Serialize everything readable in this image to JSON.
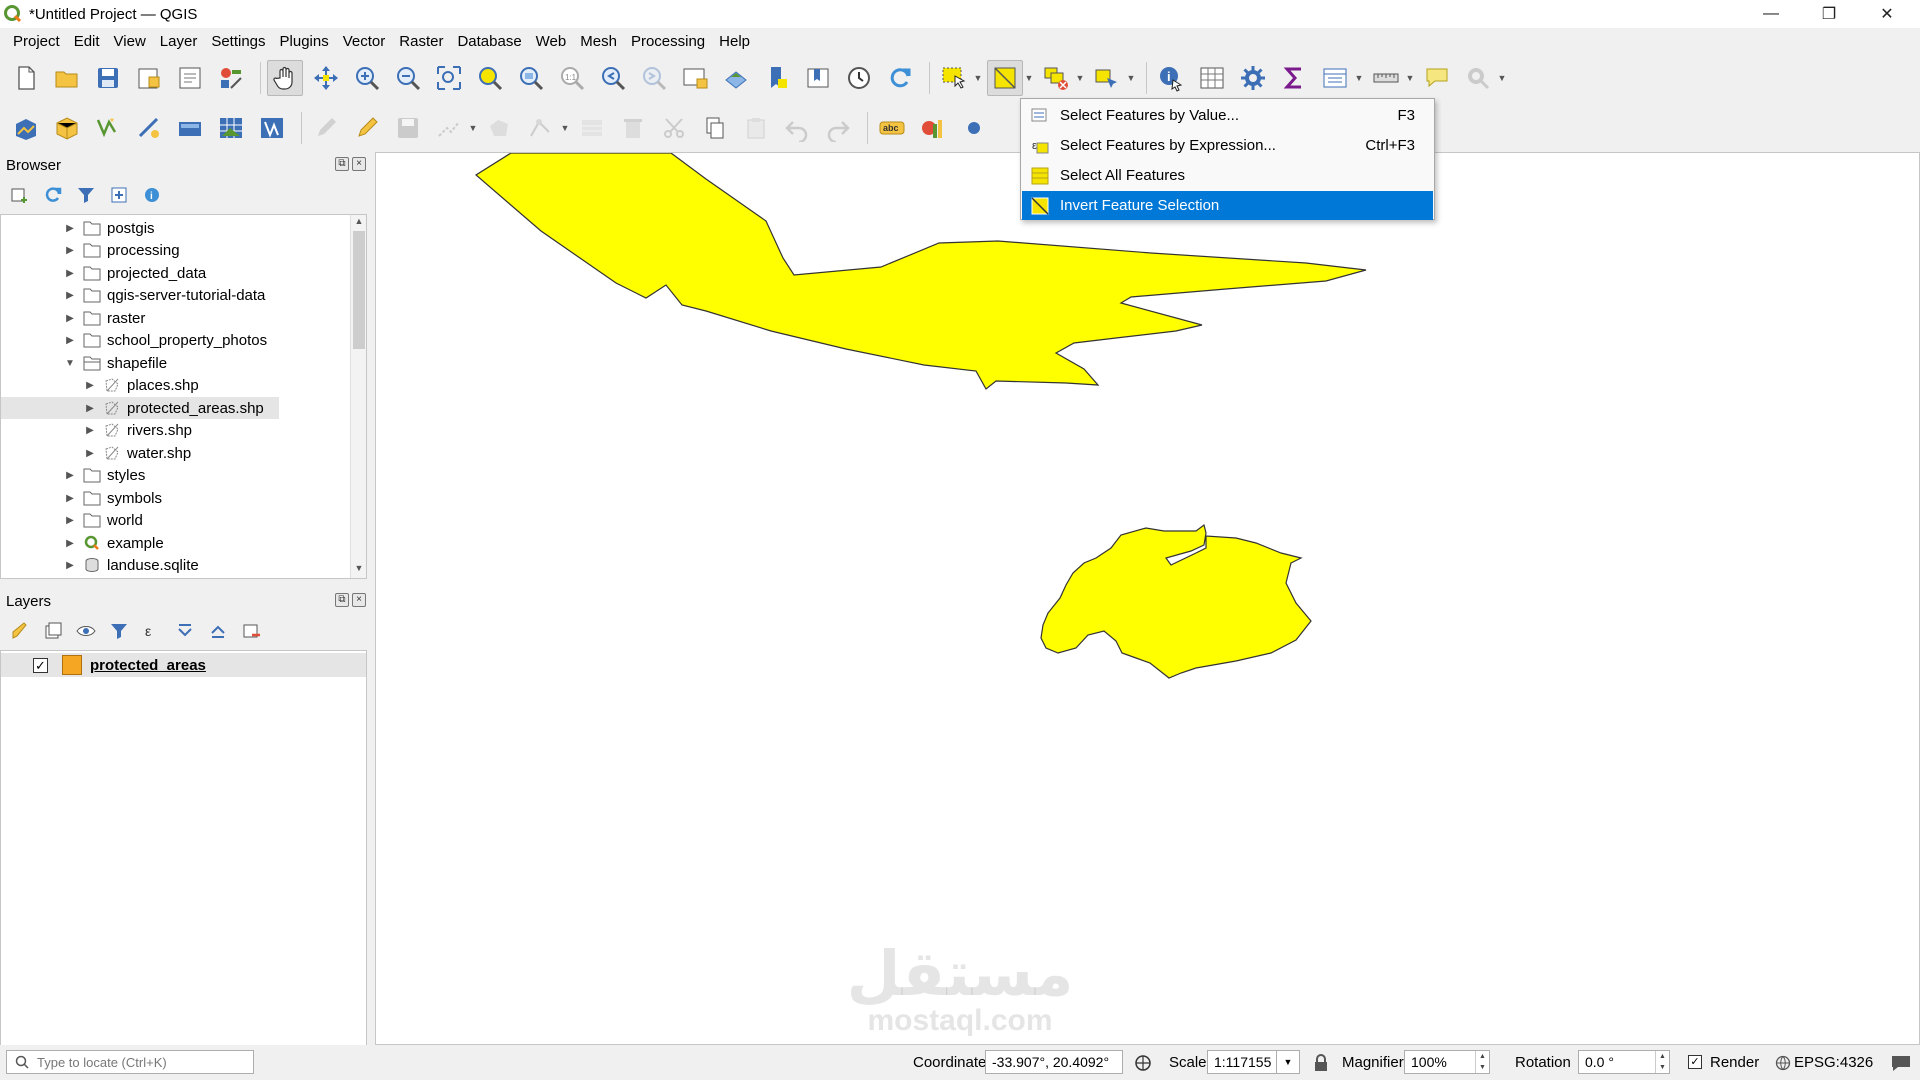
{
  "window": {
    "title": "*Untitled Project — QGIS",
    "minimize": "—",
    "maximize": "❐",
    "close": "✕"
  },
  "menu": [
    "Project",
    "Edit",
    "View",
    "Layer",
    "Settings",
    "Plugins",
    "Vector",
    "Raster",
    "Database",
    "Web",
    "Mesh",
    "Processing",
    "Help"
  ],
  "browser": {
    "title": "Browser",
    "items": [
      {
        "label": "postgis",
        "expanded": false
      },
      {
        "label": "processing",
        "expanded": false
      },
      {
        "label": "projected_data",
        "expanded": false
      },
      {
        "label": "qgis-server-tutorial-data",
        "expanded": false
      },
      {
        "label": "raster",
        "expanded": false
      },
      {
        "label": "school_property_photos",
        "expanded": false
      },
      {
        "label": "shapefile",
        "expanded": true
      },
      {
        "label": "places.shp",
        "child": true
      },
      {
        "label": "protected_areas.shp",
        "child": true,
        "selected": true
      },
      {
        "label": "rivers.shp",
        "child": true
      },
      {
        "label": "water.shp",
        "child": true
      },
      {
        "label": "styles",
        "expanded": false
      },
      {
        "label": "symbols",
        "expanded": false
      },
      {
        "label": "world",
        "expanded": false
      },
      {
        "label": "example",
        "expanded": false
      },
      {
        "label": "landuse.sqlite",
        "expanded": false
      }
    ]
  },
  "layers": {
    "title": "Layers",
    "items": [
      {
        "label": "protected_areas",
        "checked": true,
        "color": "#f5a623"
      }
    ]
  },
  "select_menu": {
    "items": [
      {
        "label": "Select Features by Value...",
        "shortcut": "F3",
        "highlighted": false
      },
      {
        "label": "Select Features by Expression...",
        "shortcut": "Ctrl+F3",
        "highlighted": false
      },
      {
        "label": "Select All Features",
        "shortcut": "",
        "highlighted": false
      },
      {
        "label": "Invert Feature Selection",
        "shortcut": "",
        "highlighted": true
      }
    ]
  },
  "map": {
    "feature_fill": "#ffff00",
    "feature_stroke": "#333333"
  },
  "watermark": {
    "arabic": "مستقل",
    "latin": "mostaql.com"
  },
  "status": {
    "locate_placeholder": "Type to locate (Ctrl+K)",
    "coordinate_label": "Coordinate",
    "coordinate_value": "-33.907°, 20.4092°",
    "scale_label": "Scale",
    "scale_value": "1:117155",
    "magnifier_label": "Magnifier",
    "magnifier_value": "100%",
    "rotation_label": "Rotation",
    "rotation_value": "0.0 °",
    "render_label": "Render",
    "render_checked": true,
    "crs": "EPSG:4326"
  }
}
